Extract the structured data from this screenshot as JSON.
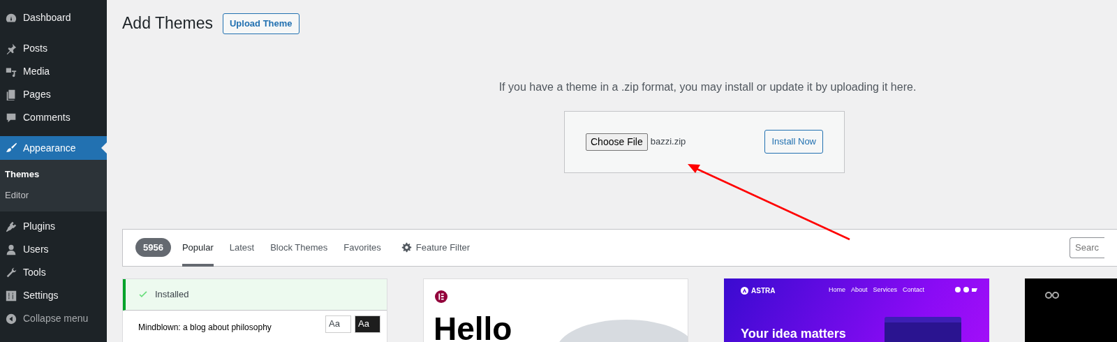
{
  "sidebar": {
    "items": [
      {
        "label": "Dashboard",
        "selected": false
      },
      {
        "label": "Posts",
        "selected": false
      },
      {
        "label": "Media",
        "selected": false
      },
      {
        "label": "Pages",
        "selected": false
      },
      {
        "label": "Comments",
        "selected": false
      },
      {
        "label": "Appearance",
        "selected": true,
        "children": [
          {
            "label": "Themes",
            "selected": true
          },
          {
            "label": "Editor",
            "selected": false
          }
        ]
      },
      {
        "label": "Plugins",
        "selected": false
      },
      {
        "label": "Users",
        "selected": false
      },
      {
        "label": "Tools",
        "selected": false
      },
      {
        "label": "Settings",
        "selected": false
      }
    ],
    "collapse": "Collapse menu"
  },
  "page": {
    "title": "Add Themes",
    "upload_button": "Upload Theme"
  },
  "upload": {
    "message": "If you have a theme in a .zip format, you may install or update it by uploading it here.",
    "choose_button": "Choose File",
    "file_name": "bazzi.zip",
    "install_button": "Install Now"
  },
  "filter": {
    "count": "5956",
    "tabs": [
      {
        "label": "Popular",
        "selected": true
      },
      {
        "label": "Latest",
        "selected": false
      },
      {
        "label": "Block Themes",
        "selected": false
      },
      {
        "label": "Favorites",
        "selected": false
      }
    ],
    "feature_filter": "Feature Filter",
    "search": {
      "placeholder": "Searc"
    }
  },
  "themes": [
    {
      "kind": "installed",
      "notice": "Installed",
      "text": "Mindblown: a blog about philosophy",
      "chips": [
        "Aa",
        "Aa"
      ]
    },
    {
      "kind": "hello",
      "text": "Hello"
    },
    {
      "kind": "astra",
      "logo": "ASTRA",
      "nav": [
        "Home",
        "About",
        "Services",
        "Contact"
      ],
      "text": "Your idea matters"
    },
    {
      "kind": "dark"
    }
  ]
}
